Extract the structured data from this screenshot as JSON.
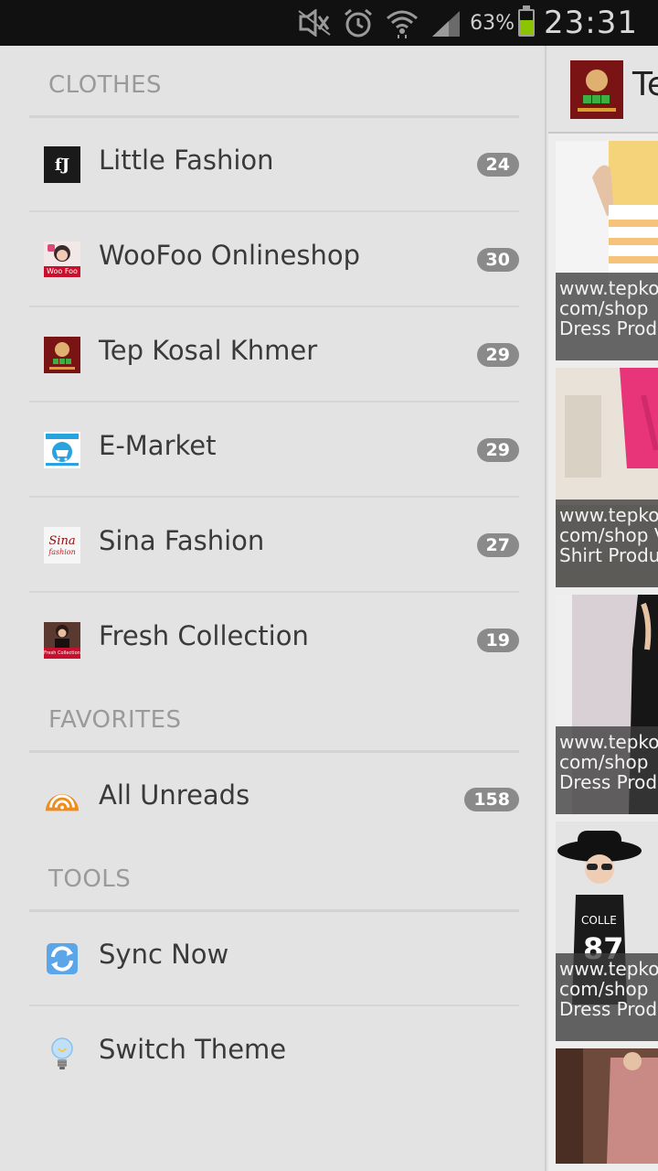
{
  "status_bar": {
    "battery_percent_label": "63%",
    "battery_level": 0.63,
    "time": "23:31",
    "icons": [
      "mute-icon",
      "alarm-icon",
      "wifi-icon",
      "signal-icon",
      "battery-icon"
    ]
  },
  "drawer": {
    "sections": [
      {
        "title": "CLOTHES",
        "items": [
          {
            "label": "Little Fashion",
            "count": "24",
            "icon": "little-fashion-logo-icon"
          },
          {
            "label": "WooFoo Onlineshop",
            "count": "30",
            "icon": "woofoo-logo-icon"
          },
          {
            "label": "Tep Kosal Khmer",
            "count": "29",
            "icon": "tep-kosal-logo-icon"
          },
          {
            "label": "E-Market",
            "count": "29",
            "icon": "e-market-logo-icon"
          },
          {
            "label": "Sina Fashion",
            "count": "27",
            "icon": "sina-fashion-logo-icon"
          },
          {
            "label": "Fresh Collection",
            "count": "19",
            "icon": "fresh-collection-logo-icon"
          }
        ]
      },
      {
        "title": "FAVORITES",
        "items": [
          {
            "label": "All Unreads",
            "count": "158",
            "icon": "rss-icon"
          }
        ]
      },
      {
        "title": "TOOLS",
        "items": [
          {
            "label": "Sync Now",
            "icon": "sync-icon"
          },
          {
            "label": "Switch Theme",
            "icon": "lightbulb-icon"
          }
        ]
      }
    ],
    "logo_text": {
      "little_fashion": "fJ",
      "woofoo": "Woo Foo",
      "sina": "Sina",
      "sina_sub": "fashion",
      "fresh": "Fresh Collection"
    }
  },
  "content": {
    "title": "Te",
    "cards": [
      {
        "lines": [
          "www.tepko",
          "com/shop",
          "Dress Prod"
        ]
      },
      {
        "lines": [
          "www.tepko",
          "com/shop V",
          "Shirt Produ"
        ]
      },
      {
        "lines": [
          "www.tepko",
          "com/shop",
          "Dress Prod"
        ]
      },
      {
        "lines": [
          "www.tepko",
          "com/shop",
          "Dress Prod"
        ]
      }
    ]
  },
  "colors": {
    "status_bar_bg": "#111111",
    "drawer_bg": "#e3e3e3",
    "badge_bg": "#8a8a8a",
    "battery_fill": "#8bc400",
    "rss_orange": "#f08c1e"
  }
}
